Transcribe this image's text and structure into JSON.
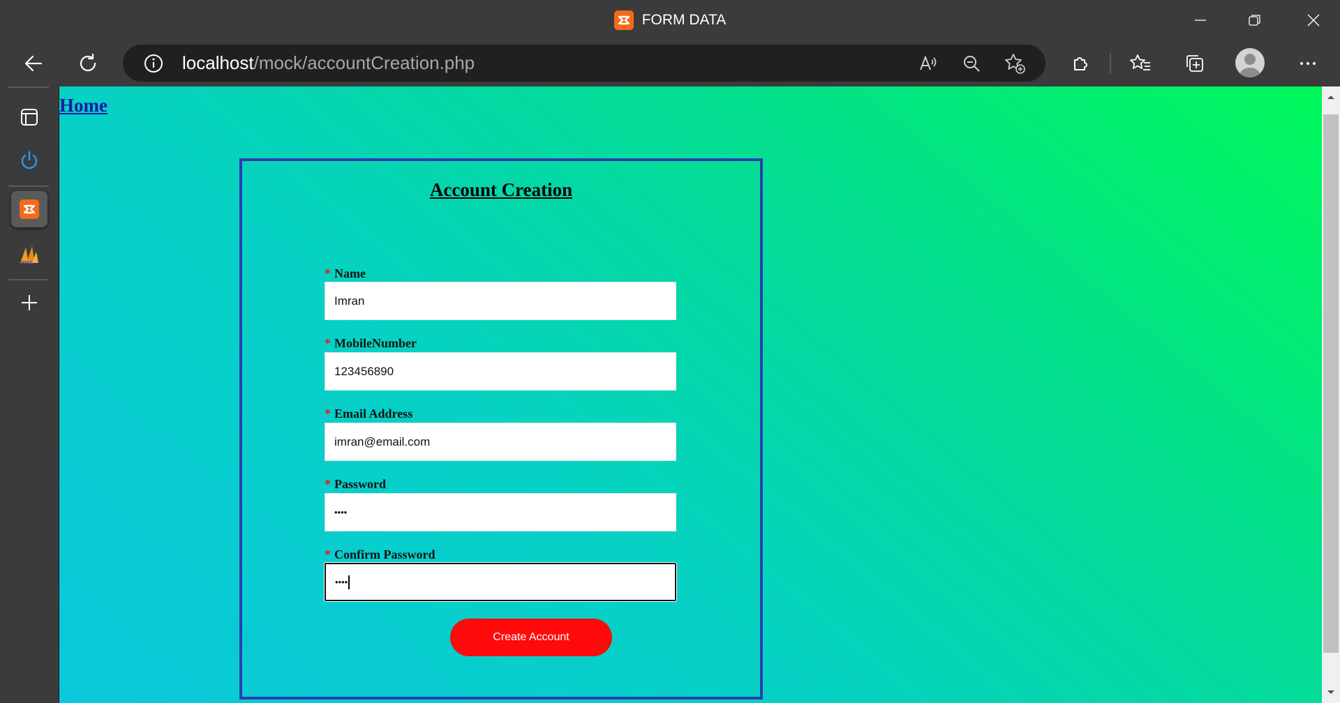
{
  "window": {
    "title": "FORM DATA",
    "app_icon": "xampp-icon"
  },
  "toolbar": {
    "url_host": "localhost",
    "url_path": "/mock/accountCreation.php"
  },
  "page": {
    "home_link": "Home",
    "form": {
      "title": "Account Creation",
      "required_marker": "*",
      "fields": [
        {
          "label": "Name",
          "value": "Imran"
        },
        {
          "label": "MobileNumber",
          "value": "123456890"
        },
        {
          "label": "Email Address",
          "value": "imran@email.com"
        },
        {
          "label": "Password",
          "value": "••••"
        },
        {
          "label": "Confirm Password",
          "value": "••••"
        }
      ],
      "submit_label": "Create Account"
    }
  },
  "colors": {
    "submit_button": "#ff0a0a",
    "form_border": "#2b3fb0",
    "required_marker": "#e21b1b",
    "gradient_start": "#0bc7dc",
    "gradient_end": "#00f85a"
  }
}
